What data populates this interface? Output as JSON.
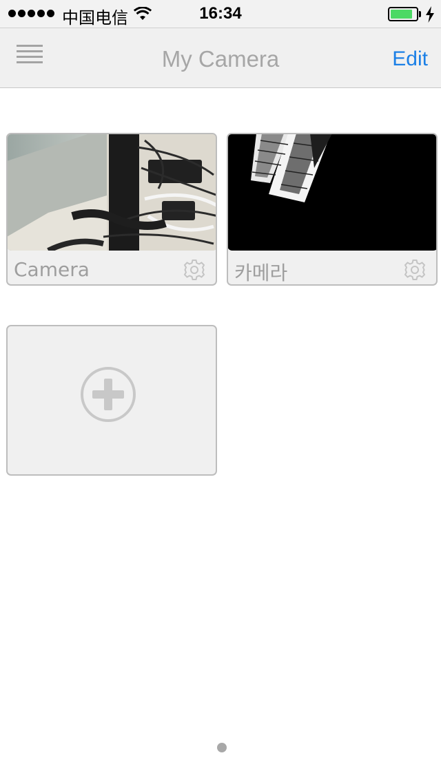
{
  "status_bar": {
    "carrier": "中国电信",
    "time": "16:34",
    "battery_level": 0.85,
    "battery_color": "#4cd964",
    "icons": [
      "signal-dots",
      "wifi-icon",
      "battery-icon",
      "charging-bolt-icon"
    ]
  },
  "nav": {
    "title": "My Camera",
    "edit_label": "Edit",
    "accent_color": "#1a7fe6",
    "menu_icon": "hamburger-icon"
  },
  "cameras": [
    {
      "name": "Camera",
      "settings_icon": "gear-icon"
    },
    {
      "name": "카메라",
      "settings_icon": "gear-icon"
    }
  ],
  "add_camera": {
    "icon": "plus-circle-icon"
  },
  "pager": {
    "pages": 1,
    "current": 1
  }
}
